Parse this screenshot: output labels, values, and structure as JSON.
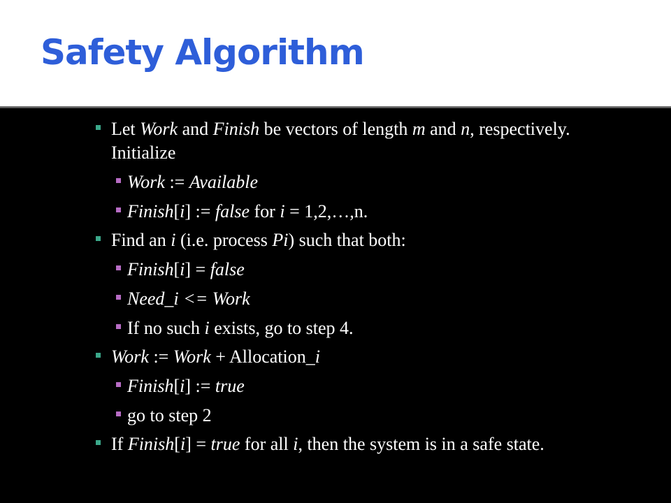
{
  "title": "Safety Algorithm",
  "colors": {
    "title": "#2e5ed9",
    "bullet_level1": "#3ba88a",
    "bullet_level2": "#b76cc4",
    "background": "#000000",
    "title_band": "#ffffff"
  },
  "b1": {
    "t1": "Let ",
    "t2": "Work",
    "t3": " and ",
    "t4": "Finish",
    "t5": " be vectors of length ",
    "t6": "m",
    "t7": " and ",
    "t8": "n",
    "t9": ", respectively.  Initialize"
  },
  "b1a": {
    "t1": "Work",
    "t2": " := ",
    "t3": "Available"
  },
  "b1b": {
    "t1": "Finish",
    "t2": "[",
    "t3": "i",
    "t4": "] := ",
    "t5": "false",
    "t6": " for ",
    "t7": "i",
    "t8": " = 1,2,…,n."
  },
  "b2": {
    "t1": "Find an ",
    "t2": "i",
    "t3": "  (i.e. process ",
    "t4": "Pi",
    "t5": ") such that both:"
  },
  "b2a": {
    "t1": "Finish",
    "t2": "[",
    "t3": "i",
    "t4": "] = ",
    "t5": "false"
  },
  "b2b": {
    "t1": "Need_i <= Work"
  },
  "b2c": {
    "t1": "If no such ",
    "t2": "i",
    "t3": " exists, go to step 4."
  },
  "b3": {
    "t1": "Work",
    "t2": " := ",
    "t3": "Work",
    "t4": " + Allocation_",
    "t5": "i"
  },
  "b3a": {
    "t1": "Finish",
    "t2": "[",
    "t3": "i",
    "t4": "] := ",
    "t5": "true"
  },
  "b3b": {
    "t1": "go to step 2"
  },
  "b4": {
    "t1": "If ",
    "t2": "Finish",
    "t3": "[",
    "t4": "i",
    "t5": "] = ",
    "t6": "true",
    "t7": " for all ",
    "t8": "i",
    "t9": ", then the system is in a safe state."
  }
}
